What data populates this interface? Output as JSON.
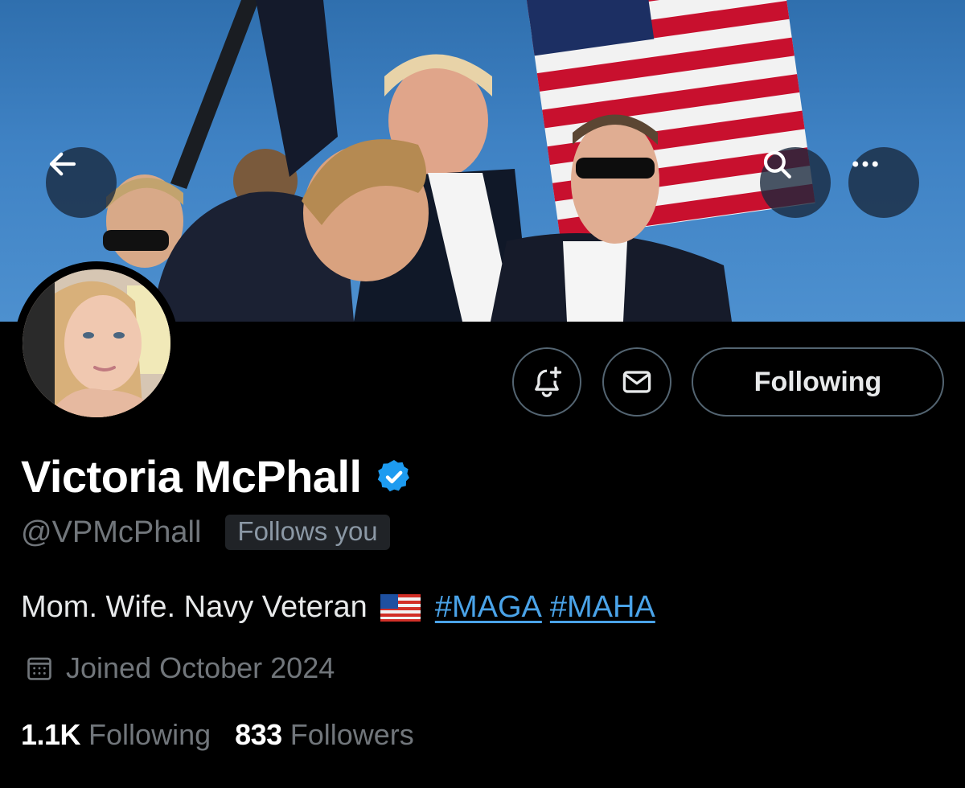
{
  "header": {
    "back_icon": "arrow-left-icon",
    "search_icon": "search-icon",
    "more_icon": "more-horizontal-icon"
  },
  "actions": {
    "notify_icon": "bell-plus-icon",
    "message_icon": "envelope-icon",
    "following_label": "Following"
  },
  "profile": {
    "display_name": "Victoria McPhall",
    "verified_icon": "verified-badge-icon",
    "handle": "@VPMcPhall",
    "follows_you_label": "Follows you",
    "bio_text": "Mom. Wife. Navy Veteran",
    "bio_flag_icon": "us-flag-emoji-icon",
    "bio_hashtags": [
      "#MAGA",
      "#MAHA"
    ],
    "joined_icon": "calendar-icon",
    "joined": "Joined October 2024"
  },
  "stats": {
    "following_count": "1.1K",
    "following_label": "Following",
    "followers_count": "833",
    "followers_label": "Followers"
  },
  "colors": {
    "background": "#000000",
    "accent_link": "#4aa3e8",
    "verified": "#1d9bf0",
    "muted_text": "#71767b",
    "border": "#536471"
  }
}
